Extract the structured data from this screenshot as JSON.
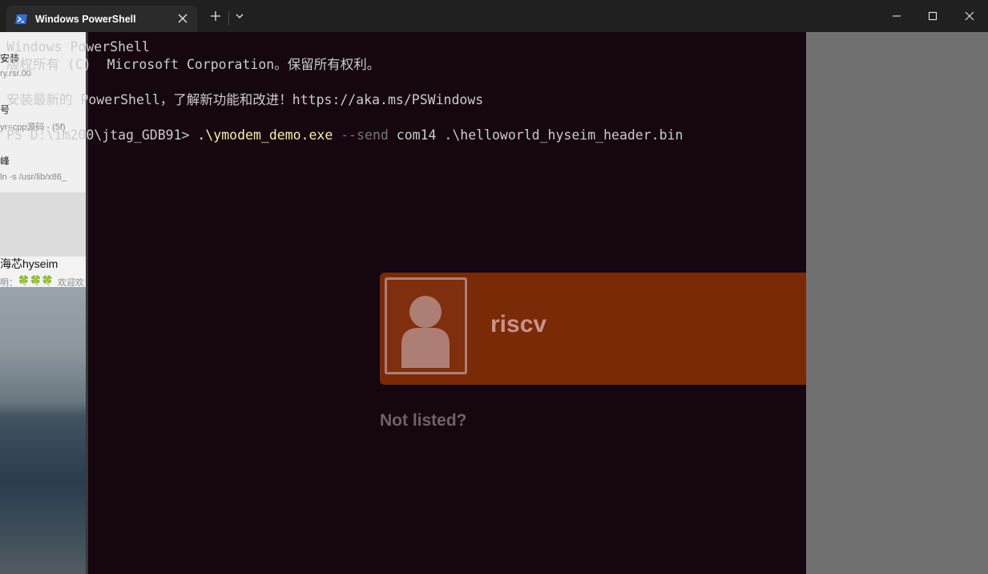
{
  "window": {
    "tab_title": "Windows PowerShell",
    "icons": {
      "tab_icon": "powershell-icon",
      "tab_close": "close-icon",
      "new_tab": "plus-icon",
      "dropdown": "chevron-down-icon",
      "minimize": "minimize-icon",
      "maximize": "maximize-icon",
      "close": "close-icon"
    }
  },
  "terminal": {
    "lines": [
      "Windows PowerShell",
      "版权所有 (C)  Microsoft Corporation。保留所有权利。",
      "",
      "安装最新的 PowerShell，了解新功能和改进！https://aka.ms/PSWindows",
      ""
    ],
    "prompt": "PS D:\\im200\\jtag_GDB91> ",
    "command": {
      "exe": ".\\ymodem_demo.exe",
      "flag": "--send",
      "args": "com14 .\\helloworld_hyseim_header.bin"
    }
  },
  "background": {
    "left_fragments": [
      "安装",
      "ry.rsr.00",
      "号",
      "yr=cpp源码 - (5f)",
      "峰",
      "ln -s /usr/lib/x86_",
      "海芯hyseim",
      "明：",
      "🍀🍀🍀",
      "欢迎欢"
    ],
    "login_user": "riscv",
    "not_listed": "Not listed?"
  },
  "colors": {
    "title_bar": "#202020",
    "tab": "#2b2b2b",
    "terminal_bg": "#150610",
    "text": "#cccccc",
    "command": "#f9f1a5",
    "parameter": "#767676",
    "login_card": "#7a2a07"
  }
}
